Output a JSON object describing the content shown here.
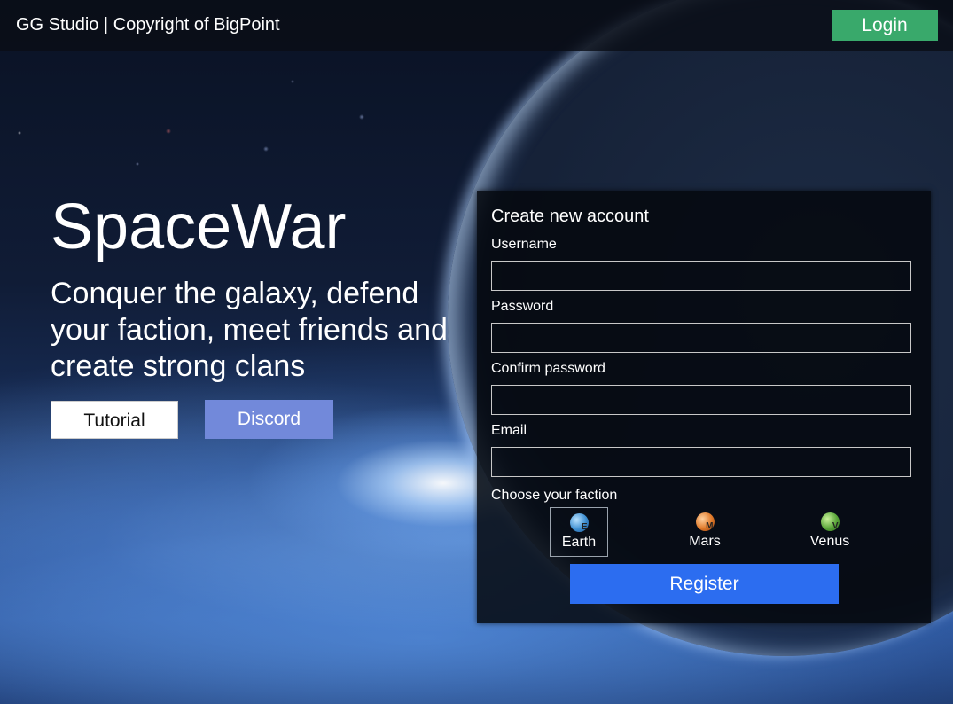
{
  "header": {
    "brand": "GG Studio | Copyright of BigPoint",
    "login_label": "Login"
  },
  "hero": {
    "title": "SpaceWar",
    "subtitle": "Conquer the galaxy, defend your faction, meet friends and create strong clans",
    "tutorial_label": "Tutorial",
    "discord_label": "Discord"
  },
  "register_form": {
    "title": "Create new account",
    "fields": [
      {
        "label": "Username",
        "value": ""
      },
      {
        "label": "Password",
        "value": ""
      },
      {
        "label": "Confirm password",
        "value": ""
      },
      {
        "label": "Email",
        "value": ""
      }
    ],
    "faction_label": "Choose your faction",
    "factions": [
      {
        "name": "Earth",
        "letter": "E",
        "icon": "earth-planet-icon",
        "selected": true
      },
      {
        "name": "Mars",
        "letter": "M",
        "icon": "mars-planet-icon",
        "selected": false
      },
      {
        "name": "Venus",
        "letter": "V",
        "icon": "venus-planet-icon",
        "selected": false
      }
    ],
    "register_label": "Register"
  },
  "colors": {
    "login_button": "#39a96b",
    "discord_button": "#7289da",
    "register_button": "#2c6df0",
    "tutorial_button": "#ffffff"
  }
}
